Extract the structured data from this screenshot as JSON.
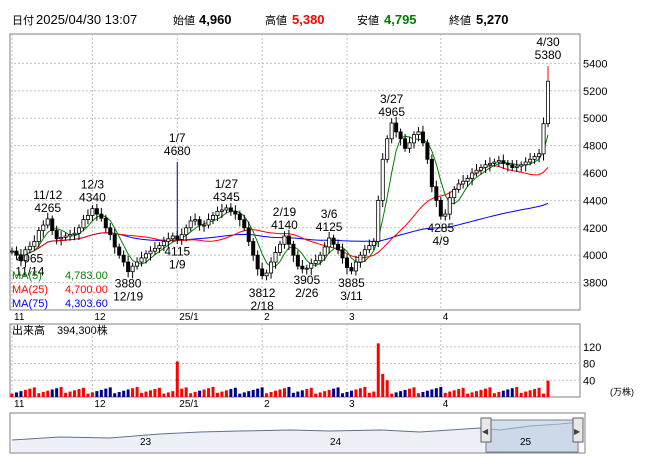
{
  "header": {
    "date_label": "日付",
    "date": "2025/04/30 13:07",
    "open_label": "始値",
    "open": "4,960",
    "high_label": "高値",
    "high": "5,380",
    "low_label": "安値",
    "low": "4,795",
    "close_label": "終値",
    "close": "5,270"
  },
  "colors": {
    "up": "#ff0000",
    "down": "#000000",
    "ma5": "#008000",
    "ma25": "#ff0000",
    "ma75": "#0000ff",
    "high_value": "#ff0000",
    "low_value": "#008000",
    "volume_up": "#ff0000",
    "volume_down": "#00008b",
    "grid": "#c0c0c0"
  },
  "ma_legend": [
    {
      "label": "MA(5)",
      "value": "4,783.00",
      "color": "#008000"
    },
    {
      "label": "MA(25)",
      "value": "4,700.00",
      "color": "#ff0000"
    },
    {
      "label": "MA(75)",
      "value": "4,303.60",
      "color": "#0000ff"
    }
  ],
  "volume": {
    "label": "出来高",
    "value": "394,300株",
    "unit": "(万株)"
  },
  "navigator": {
    "labels": [
      "23",
      "24",
      "25"
    ],
    "left_arrow": "◀",
    "right_arrow": "▶"
  },
  "chart_data": {
    "type": "candlestick",
    "ylim": [
      3600,
      5600
    ],
    "y_ticks": [
      3800,
      4000,
      4200,
      4400,
      4600,
      4800,
      5000,
      5200,
      5400
    ],
    "x_labels": [
      {
        "label": "11",
        "index": 0
      },
      {
        "label": "12",
        "index": 18
      },
      {
        "label": "25/1",
        "index": 37
      },
      {
        "label": "2",
        "index": 56
      },
      {
        "label": "3",
        "index": 75
      },
      {
        "label": "4",
        "index": 96
      }
    ],
    "x_count": 121,
    "points": [
      [
        0,
        4030
      ],
      [
        1,
        4000
      ],
      [
        2,
        3960
      ],
      [
        3,
        4040
      ],
      [
        4,
        4065
      ],
      [
        5,
        4100
      ],
      [
        6,
        4180
      ],
      [
        7,
        4220
      ],
      [
        8,
        4265
      ],
      [
        9,
        4180
      ],
      [
        10,
        4120
      ],
      [
        11,
        4130
      ],
      [
        12,
        4140
      ],
      [
        13,
        4150
      ],
      [
        14,
        4160
      ],
      [
        15,
        4200
      ],
      [
        16,
        4260
      ],
      [
        17,
        4290
      ],
      [
        18,
        4340
      ],
      [
        19,
        4300
      ],
      [
        20,
        4270
      ],
      [
        21,
        4200
      ],
      [
        22,
        4150
      ],
      [
        23,
        4060
      ],
      [
        24,
        4000
      ],
      [
        25,
        3950
      ],
      [
        26,
        3880
      ],
      [
        27,
        3920
      ],
      [
        28,
        3950
      ],
      [
        29,
        3980
      ],
      [
        30,
        4010
      ],
      [
        31,
        4030
      ],
      [
        32,
        4050
      ],
      [
        33,
        4070
      ],
      [
        34,
        4100
      ],
      [
        35,
        4120
      ],
      [
        36,
        4140
      ],
      [
        37,
        4115
      ],
      [
        38,
        4150
      ],
      [
        39,
        4200
      ],
      [
        40,
        4250
      ],
      [
        41,
        4260
      ],
      [
        42,
        4220
      ],
      [
        43,
        4220
      ],
      [
        44,
        4260
      ],
      [
        45,
        4290
      ],
      [
        46,
        4320
      ],
      [
        47,
        4330
      ],
      [
        48,
        4345
      ],
      [
        49,
        4320
      ],
      [
        50,
        4300
      ],
      [
        51,
        4260
      ],
      [
        52,
        4200
      ],
      [
        53,
        4100
      ],
      [
        54,
        4000
      ],
      [
        55,
        3900
      ],
      [
        56,
        3850
      ],
      [
        57,
        3870
      ],
      [
        58,
        3950
      ],
      [
        59,
        4020
      ],
      [
        60,
        4080
      ],
      [
        61,
        4140
      ],
      [
        62,
        4080
      ],
      [
        63,
        4000
      ],
      [
        64,
        3920
      ],
      [
        65,
        3900
      ],
      [
        66,
        3905
      ],
      [
        67,
        3940
      ],
      [
        68,
        3960
      ],
      [
        69,
        4000
      ],
      [
        70,
        4060
      ],
      [
        71,
        4125
      ],
      [
        72,
        4080
      ],
      [
        73,
        4040
      ],
      [
        74,
        3980
      ],
      [
        75,
        3910
      ],
      [
        76,
        3885
      ],
      [
        77,
        3950
      ],
      [
        78,
        4000
      ],
      [
        79,
        4040
      ],
      [
        80,
        4070
      ],
      [
        81,
        4100
      ],
      [
        82,
        4400
      ],
      [
        83,
        4700
      ],
      [
        84,
        4850
      ],
      [
        85,
        4965
      ],
      [
        86,
        4900
      ],
      [
        87,
        4850
      ],
      [
        88,
        4780
      ],
      [
        89,
        4820
      ],
      [
        90,
        4880
      ],
      [
        91,
        4900
      ],
      [
        92,
        4820
      ],
      [
        93,
        4700
      ],
      [
        94,
        4500
      ],
      [
        95,
        4400
      ],
      [
        96,
        4285
      ],
      [
        97,
        4300
      ],
      [
        98,
        4420
      ],
      [
        99,
        4480
      ],
      [
        100,
        4520
      ],
      [
        101,
        4540
      ],
      [
        102,
        4560
      ],
      [
        103,
        4600
      ],
      [
        104,
        4620
      ],
      [
        105,
        4640
      ],
      [
        106,
        4660
      ],
      [
        107,
        4670
      ],
      [
        108,
        4680
      ],
      [
        109,
        4690
      ],
      [
        110,
        4670
      ],
      [
        111,
        4660
      ],
      [
        112,
        4640
      ],
      [
        113,
        4650
      ],
      [
        114,
        4660
      ],
      [
        115,
        4680
      ],
      [
        116,
        4700
      ],
      [
        117,
        4720
      ],
      [
        118,
        4740
      ],
      [
        119,
        4960
      ],
      [
        120,
        5270
      ]
    ],
    "annotations": [
      {
        "label": "11/12",
        "value": "4265",
        "index": 8,
        "type": "high"
      },
      {
        "label": "12/3",
        "value": "4340",
        "index": 18,
        "type": "high"
      },
      {
        "label": "1/7",
        "value": "4680",
        "index": 37,
        "type": "high"
      },
      {
        "label": "1/27",
        "value": "4345",
        "index": 48,
        "type": "high"
      },
      {
        "label": "2/19",
        "value": "4140",
        "index": 61,
        "type": "high"
      },
      {
        "label": "3/6",
        "value": "4125",
        "index": 71,
        "type": "high"
      },
      {
        "label": "3/27",
        "value": "4965",
        "index": 85,
        "type": "high"
      },
      {
        "label": "4/30",
        "value": "5380",
        "index": 120,
        "type": "high"
      }
    ],
    "low_annotations": [
      {
        "text": "4065",
        "index": 4
      },
      {
        "text": "11/14",
        "index": 4
      },
      {
        "text": "3880",
        "index": 26
      },
      {
        "text": "12/19",
        "index": 26
      },
      {
        "text": "4115",
        "index": 37
      },
      {
        "text": "1/9",
        "index": 37
      },
      {
        "text": "3812",
        "index": 56
      },
      {
        "text": "2/18",
        "index": 56
      },
      {
        "text": "3905",
        "index": 66
      },
      {
        "text": "2/26",
        "index": 66
      },
      {
        "text": "3885",
        "index": 76
      },
      {
        "text": "3/11",
        "index": 76
      },
      {
        "text": "4285",
        "index": 96
      },
      {
        "text": "4/9",
        "index": 96
      }
    ],
    "volume_ylim": [
      0,
      160
    ],
    "volume_ticks": [
      40,
      80,
      120
    ],
    "volume_spikes": [
      {
        "index": 37,
        "value": 85
      },
      {
        "index": 82,
        "value": 128
      },
      {
        "index": 83,
        "value": 55
      },
      {
        "index": 84,
        "value": 40
      },
      {
        "index": 120,
        "value": 39
      }
    ]
  }
}
